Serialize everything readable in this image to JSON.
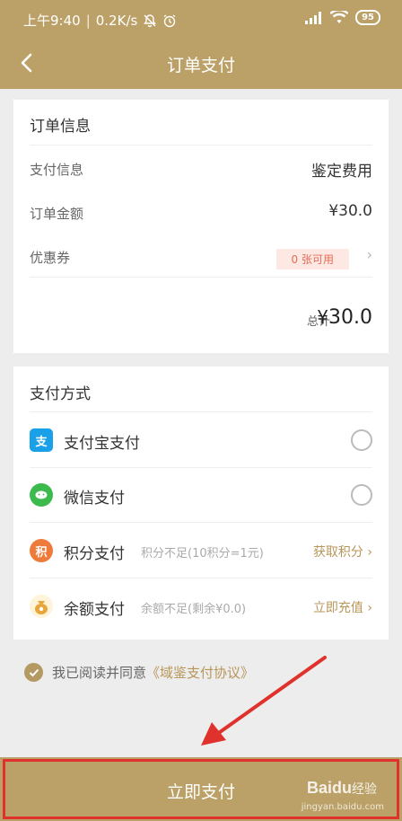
{
  "status_bar": {
    "time": "上午9:40",
    "network_speed": "0.2K/s",
    "battery": "95",
    "icons": [
      "mute-icon",
      "alarm-icon",
      "signal-icon",
      "wifi-icon",
      "battery-icon"
    ]
  },
  "header": {
    "title": "订单支付"
  },
  "order_info": {
    "section_title": "订单信息",
    "rows": [
      {
        "label": "支付信息",
        "value": "鉴定费用"
      },
      {
        "label": "订单金额",
        "value": "¥30.0"
      },
      {
        "label": "优惠券",
        "value": "0 张可用"
      }
    ],
    "total_label": "总计",
    "total_currency": "¥",
    "total_value": "30.0"
  },
  "payment": {
    "section_title": "支付方式",
    "methods": [
      {
        "label": "支付宝支付",
        "icon": "alipay-icon",
        "icon_glyph": "支",
        "color": "#1aa0e8"
      },
      {
        "label": "微信支付",
        "icon": "wechat-icon",
        "icon_glyph": "",
        "color": "#3dba4e"
      },
      {
        "label": "积分支付",
        "icon": "points-icon",
        "icon_glyph": "积",
        "color": "#ee7b3a",
        "note": "积分不足(10积分=1元)",
        "link": "获取积分"
      },
      {
        "label": "余额支付",
        "icon": "balance-icon",
        "icon_glyph": "",
        "color": "#e8a53a",
        "note": "余额不足(剩余¥0.0)",
        "link": "立即充值"
      }
    ]
  },
  "agreement": {
    "prefix": "我已阅读并同意",
    "link": "《域鉴支付协议》",
    "checked": true
  },
  "pay_button": {
    "label": "立即支付"
  },
  "watermark": {
    "brand": "Bai",
    "brand_paw": "du",
    "suffix": "经验",
    "url": "jingyan.baidu.com"
  },
  "colors": {
    "accent": "#bba167",
    "link": "#b8965a",
    "highlight": "#e0322c"
  }
}
